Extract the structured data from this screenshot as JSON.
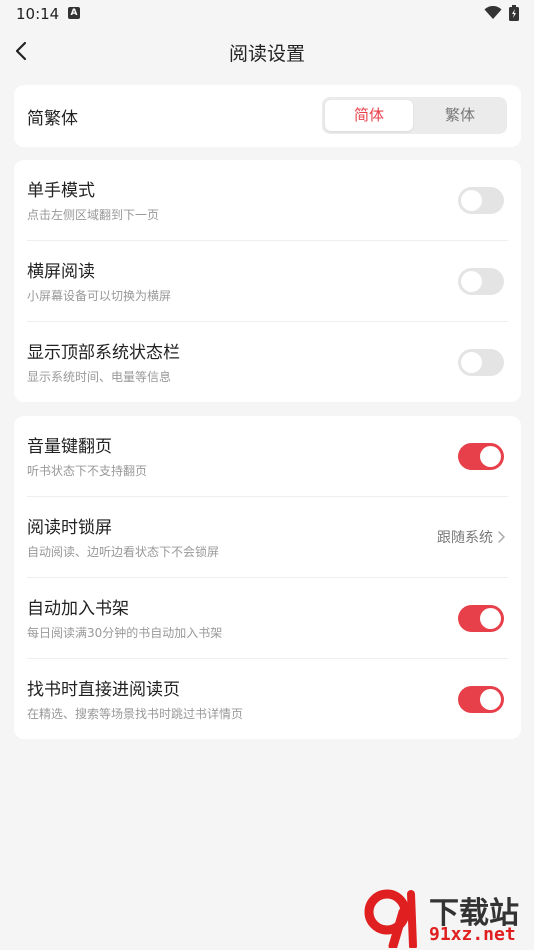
{
  "status_bar": {
    "time": "10:14",
    "notification_icon": "a-box-icon"
  },
  "header": {
    "title": "阅读设置"
  },
  "script_card": {
    "label": "简繁体",
    "options": [
      "简体",
      "繁体"
    ],
    "selected": "简体"
  },
  "card2": {
    "items": [
      {
        "title": "单手模式",
        "subtitle": "点击左侧区域翻到下一页",
        "enabled": false
      },
      {
        "title": "横屏阅读",
        "subtitle": "小屏幕设备可以切换为横屏",
        "enabled": false
      },
      {
        "title": "显示顶部系统状态栏",
        "subtitle": "显示系统时间、电量等信息",
        "enabled": false
      }
    ]
  },
  "card3": {
    "items": [
      {
        "title": "音量键翻页",
        "subtitle": "听书状态下不支持翻页",
        "enabled": true
      },
      {
        "title": "阅读时锁屏",
        "subtitle": "自动阅读、边听边看状态下不会锁屏",
        "value": "跟随系统"
      },
      {
        "title": "自动加入书架",
        "subtitle": "每日阅读满30分钟的书自动加入书架",
        "enabled": true
      },
      {
        "title": "找书时直接进阅读页",
        "subtitle": "在精选、搜索等场景找书时跳过书详情页",
        "enabled": true
      }
    ]
  },
  "watermark": {
    "top": "下载站",
    "bottom": "91xz.net"
  },
  "colors": {
    "accent": "#e8404a",
    "background": "#f5f5f5",
    "toggle_off": "#e4e4e4"
  }
}
